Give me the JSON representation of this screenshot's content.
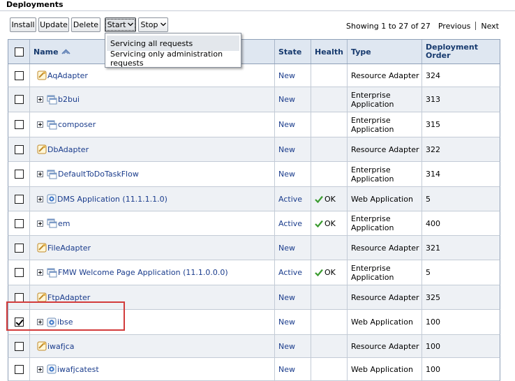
{
  "section": {
    "title": "Deployments"
  },
  "toolbar": {
    "install": "Install",
    "update": "Update",
    "delete": "Delete",
    "start": "Start",
    "stop": "Stop"
  },
  "pager": {
    "info": "Showing 1 to 27 of 27",
    "previous": "Previous",
    "next": "Next"
  },
  "start_menu": {
    "items": [
      "Servicing all requests",
      "Servicing only administration requests"
    ]
  },
  "table": {
    "headers": {
      "name": "Name",
      "state": "State",
      "health": "Health",
      "type": "Type",
      "order_line1": "Deployment",
      "order_line2": "Order"
    },
    "rows": [
      {
        "name": "AqAdapter",
        "state": "New",
        "health": "",
        "type1": "Resource Adapter",
        "type2": "",
        "order": "324",
        "checked": false
      },
      {
        "name": "b2bui",
        "state": "New",
        "health": "",
        "type1": "Enterprise",
        "type2": "Application",
        "order": "313",
        "checked": false
      },
      {
        "name": "composer",
        "state": "New",
        "health": "",
        "type1": "Enterprise",
        "type2": "Application",
        "order": "315",
        "checked": false
      },
      {
        "name": "DbAdapter",
        "state": "New",
        "health": "",
        "type1": "Resource Adapter",
        "type2": "",
        "order": "322",
        "checked": false
      },
      {
        "name": "DefaultToDoTaskFlow",
        "state": "New",
        "health": "",
        "type1": "Enterprise",
        "type2": "Application",
        "order": "314",
        "checked": false
      },
      {
        "name": "DMS Application (11.1.1.1.0)",
        "state": "Active",
        "health": "OK",
        "type1": "Web Application",
        "type2": "",
        "order": "5",
        "checked": false
      },
      {
        "name": "em",
        "state": "Active",
        "health": "OK",
        "type1": "Enterprise",
        "type2": "Application",
        "order": "400",
        "checked": false
      },
      {
        "name": "FileAdapter",
        "state": "New",
        "health": "",
        "type1": "Resource Adapter",
        "type2": "",
        "order": "321",
        "checked": false
      },
      {
        "name": "FMW Welcome Page Application (11.1.0.0.0)",
        "state": "Active",
        "health": "OK",
        "type1": "Enterprise",
        "type2": "Application",
        "order": "5",
        "checked": false
      },
      {
        "name": "FtpAdapter",
        "state": "New",
        "health": "",
        "type1": "Resource Adapter",
        "type2": "",
        "order": "325",
        "checked": false
      },
      {
        "name": "ibse",
        "state": "New",
        "health": "",
        "type1": "Web Application",
        "type2": "",
        "order": "100",
        "checked": true
      },
      {
        "name": "iwafjca",
        "state": "New",
        "health": "",
        "type1": "Resource Adapter",
        "type2": "",
        "order": "100",
        "checked": false
      },
      {
        "name": "iwafjcatest",
        "state": "New",
        "health": "",
        "type1": "Web Application",
        "type2": "",
        "order": "100",
        "checked": false
      }
    ]
  }
}
